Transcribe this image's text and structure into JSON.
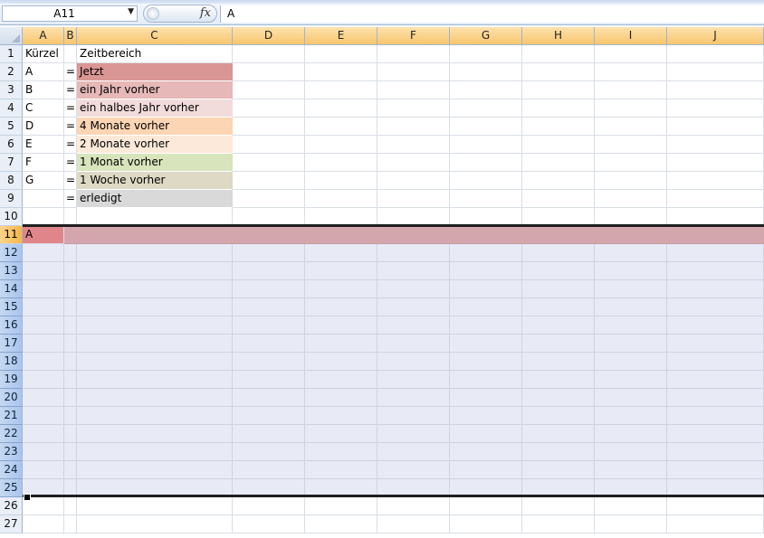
{
  "formula_bar": {
    "name_box": "A11",
    "fx_label": "fx",
    "formula_value": "A"
  },
  "columns": [
    "A",
    "B",
    "C",
    "D",
    "E",
    "F",
    "G",
    "H",
    "I",
    "J"
  ],
  "rows": [
    "1",
    "2",
    "3",
    "4",
    "5",
    "6",
    "7",
    "8",
    "9",
    "10",
    "11",
    "12",
    "13",
    "14",
    "15",
    "16",
    "17",
    "18",
    "19",
    "20",
    "21",
    "22",
    "23",
    "24",
    "25",
    "26",
    "27"
  ],
  "selection": {
    "active_row": "11",
    "selected_rows_from": "11",
    "selected_rows_to": "25"
  },
  "cells": {
    "A1": "Kürzel",
    "C1": "Zeitbereich",
    "A2": "A",
    "B2": "=",
    "C2": "Jetzt",
    "A3": "B",
    "B3": "=",
    "C3": "ein Jahr vorher",
    "A4": "C",
    "B4": "=",
    "C4": "ein halbes Jahr vorher",
    "A5": "D",
    "B5": "=",
    "C5": "4 Monate vorher",
    "A6": "E",
    "B6": "=",
    "C6": "2 Monate vorher",
    "A7": "F",
    "B7": "=",
    "C7": "1 Monat vorher",
    "A8": "G",
    "B8": "=",
    "C8": "1 Woche vorher",
    "B9": "=",
    "C9": "erledigt",
    "A11": "A"
  },
  "cell_fills": {
    "C2": "#da9694",
    "C3": "#e6b8b7",
    "C4": "#f2dcdb",
    "C5": "#fcd5b4",
    "C6": "#fde9d9",
    "C7": "#d8e4bc",
    "C8": "#ddd9c4",
    "C9": "#d9d9d9"
  }
}
